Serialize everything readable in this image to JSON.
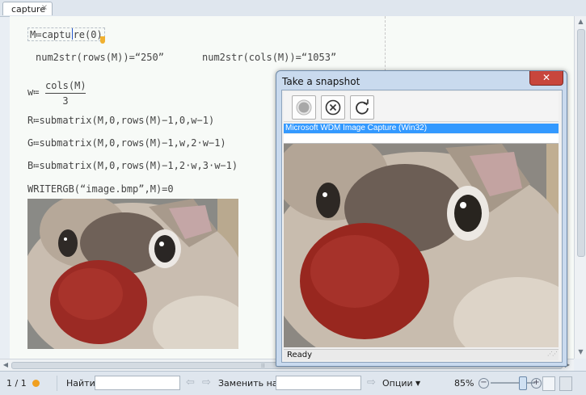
{
  "tab": {
    "label": "capture"
  },
  "worksheet": {
    "line1": {
      "prefix": "M≔captu",
      "suffix": "re(0)"
    },
    "line2a": "num2str(rows(M))=“250”",
    "line2b": "num2str(cols(M))=“1053”",
    "line3": {
      "lhs": "w≔",
      "num": "cols(M)",
      "den": "3"
    },
    "line4": "R≔submatrix(M,0,rows(M)−1,0,w−1)",
    "line5": "G≔submatrix(M,0,rows(M)−1,w,2·w−1)",
    "line6": "B≔submatrix(M,0,rows(M)−1,2·w,3·w−1)",
    "line7": "WRITERGB(“image.bmp”,M)=0"
  },
  "dialog": {
    "title": "Take a snapshot",
    "close_label": "✕",
    "tools": [
      "record-icon",
      "cancel-icon",
      "refresh-icon"
    ],
    "device": "Microsoft WDM Image Capture (Win32)",
    "status": "Ready"
  },
  "statusbar": {
    "page": "1 / 1",
    "find_label": "Найти:",
    "find_value": "",
    "replace_label": "Заменить на:",
    "replace_value": "",
    "options_label": "Опции",
    "zoom": "85%"
  },
  "colors": {
    "accent": "#3399ff",
    "close_red": "#c8463c",
    "status_dot": "#f0a020",
    "cursor": "#2255cc"
  }
}
